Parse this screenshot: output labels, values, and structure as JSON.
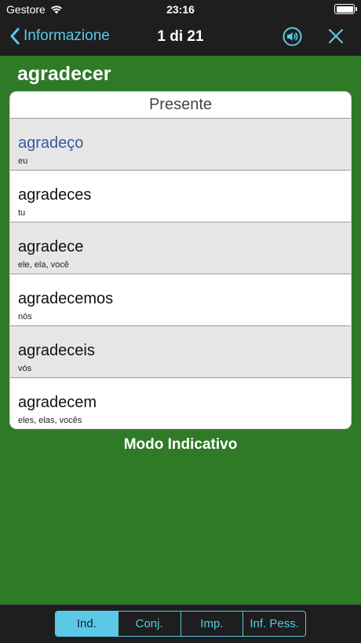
{
  "status": {
    "carrier": "Gestore",
    "time": "23:16"
  },
  "nav": {
    "back_label": "Informazione",
    "title": "1 di 21"
  },
  "verb": "agradecer",
  "tense": "Presente",
  "rows": [
    {
      "form": "agradeço",
      "pronoun": "eu"
    },
    {
      "form": "agradeces",
      "pronoun": "tu"
    },
    {
      "form": "agradece",
      "pronoun": "ele, ela, você"
    },
    {
      "form": "agradecemos",
      "pronoun": "nós"
    },
    {
      "form": "agradeceis",
      "pronoun": "vós"
    },
    {
      "form": "agradecem",
      "pronoun": "eles, elas, vocês"
    }
  ],
  "mode": "Modo Indicativo",
  "tabs": [
    {
      "label": "Ind.",
      "selected": true
    },
    {
      "label": "Conj.",
      "selected": false
    },
    {
      "label": "Imp.",
      "selected": false
    },
    {
      "label": "Inf. Pess.",
      "selected": false
    }
  ],
  "colors": {
    "background": "#2e7a27",
    "accent": "#5ac8e6",
    "bar": "#1e1e1e",
    "highlight": "#375a9b"
  }
}
